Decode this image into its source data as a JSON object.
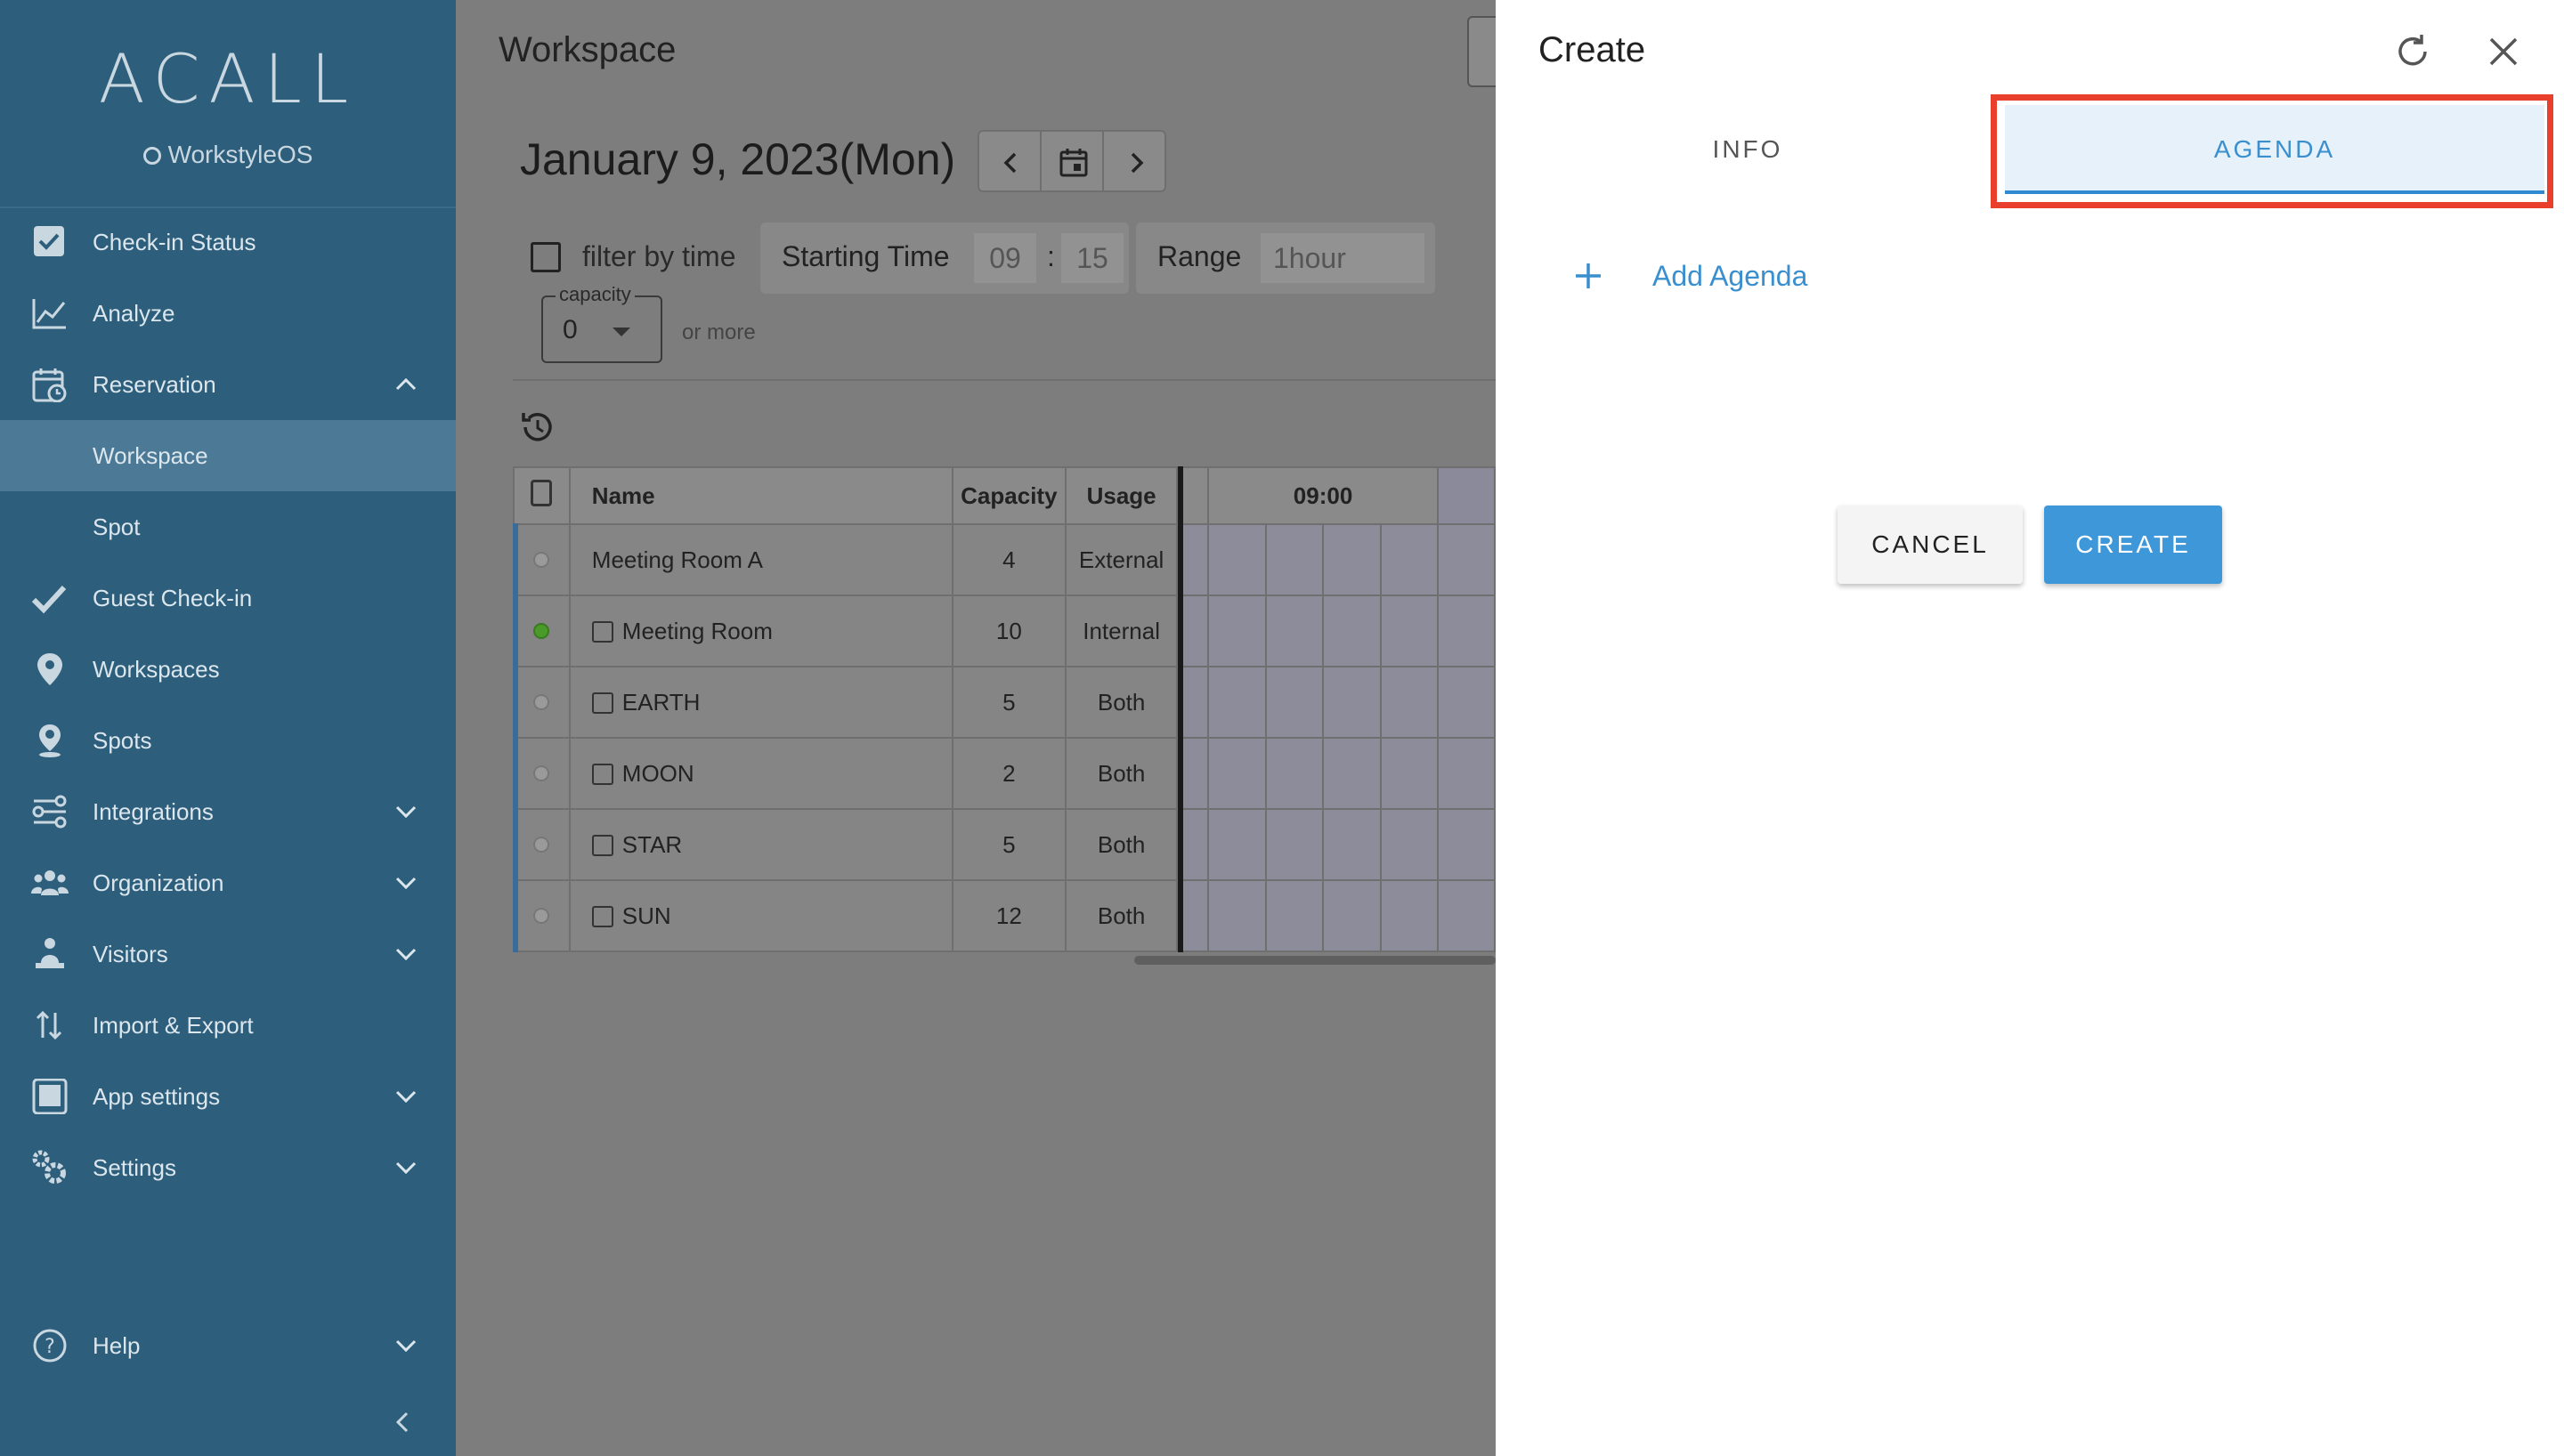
{
  "sidebar": {
    "logo": "ACALL",
    "brand": "WorkstyleOS",
    "items": [
      {
        "label": "Check-in Status"
      },
      {
        "label": "Analyze"
      },
      {
        "label": "Reservation"
      },
      {
        "label": "Workspace"
      },
      {
        "label": "Spot"
      },
      {
        "label": "Guest Check-in"
      },
      {
        "label": "Workspaces"
      },
      {
        "label": "Spots"
      },
      {
        "label": "Integrations"
      },
      {
        "label": "Organization"
      },
      {
        "label": "Visitors"
      },
      {
        "label": "Import & Export"
      },
      {
        "label": "App settings"
      },
      {
        "label": "Settings"
      },
      {
        "label": "Help"
      }
    ]
  },
  "main": {
    "title": "Workspace",
    "date": "January 9, 2023(Mon)",
    "filter": {
      "label": "filter by time",
      "starting_time_label": "Starting Time",
      "hour": "09",
      "colon": ":",
      "minute": "15",
      "range_label": "Range",
      "range_value": "1hour"
    },
    "capacity": {
      "legend": "capacity",
      "value": "0",
      "suffix": "or more"
    },
    "table": {
      "headers": {
        "name": "Name",
        "capacity": "Capacity",
        "usage": "Usage",
        "time": "09:00"
      },
      "rows": [
        {
          "name": "Meeting Room A",
          "capacity": "4",
          "usage": "External"
        },
        {
          "name": "Meeting Room",
          "capacity": "10",
          "usage": "Internal"
        },
        {
          "name": "EARTH",
          "capacity": "5",
          "usage": "Both"
        },
        {
          "name": "MOON",
          "capacity": "2",
          "usage": "Both"
        },
        {
          "name": "STAR",
          "capacity": "5",
          "usage": "Both"
        },
        {
          "name": "SUN",
          "capacity": "12",
          "usage": "Both"
        }
      ]
    }
  },
  "panel": {
    "title": "Create",
    "tabs": [
      {
        "label": "INFO"
      },
      {
        "label": "AGENDA"
      }
    ],
    "active_tab": "AGENDA",
    "add_agenda": "Add Agenda",
    "cancel": "CANCEL",
    "create": "CREATE"
  },
  "colors": {
    "sidebar_bg": "#2d5e7c",
    "accent": "#3d97d9",
    "highlight": "#e8402c"
  }
}
